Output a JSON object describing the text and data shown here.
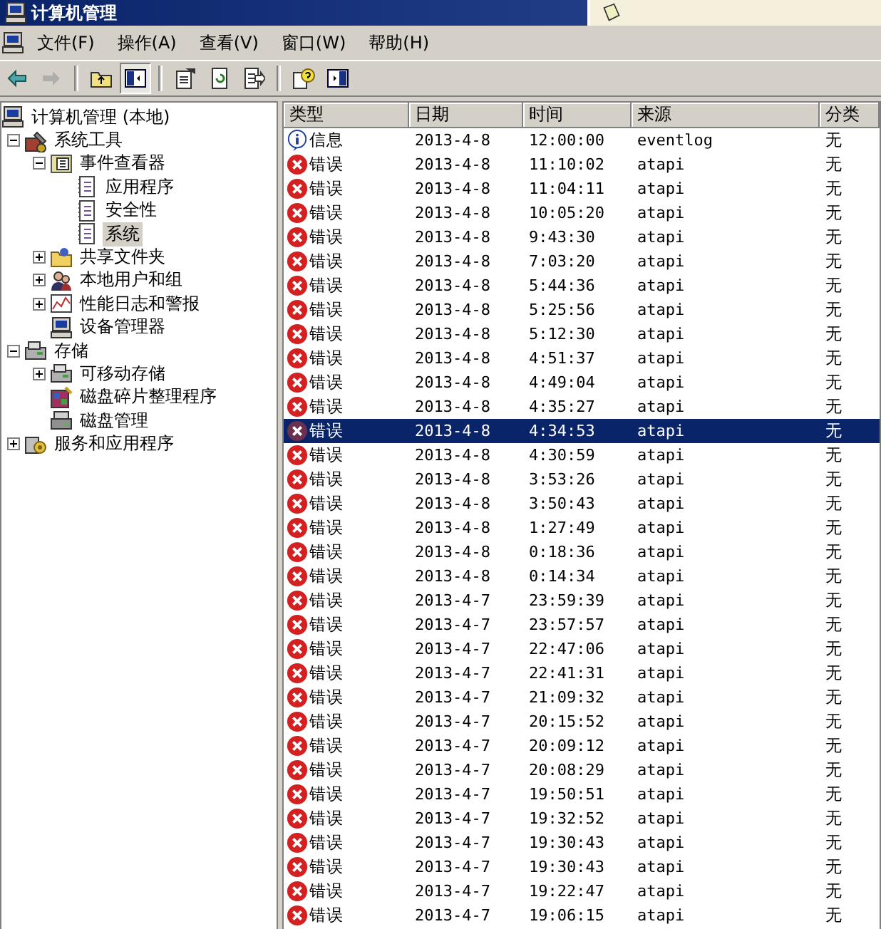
{
  "window": {
    "title": "计算机管理"
  },
  "menu": [
    "文件(F)",
    "操作(A)",
    "查看(V)",
    "窗口(W)",
    "帮助(H)"
  ],
  "toolbar": [
    {
      "kind": "back",
      "pressed": false,
      "disabled": false
    },
    {
      "kind": "forward",
      "pressed": false,
      "disabled": true
    },
    {
      "kind": "up",
      "pressed": false,
      "disabled": false
    },
    {
      "kind": "tree",
      "pressed": true,
      "disabled": false
    },
    {
      "kind": "properties",
      "pressed": false,
      "disabled": false
    },
    {
      "kind": "refresh",
      "pressed": false,
      "disabled": false
    },
    {
      "kind": "export",
      "pressed": false,
      "disabled": false
    },
    {
      "kind": "help",
      "pressed": false,
      "disabled": false
    },
    {
      "kind": "pane",
      "pressed": false,
      "disabled": false
    }
  ],
  "tree": {
    "label": "计算机管理 (本地)",
    "kind": "computer",
    "selected": false,
    "children": [
      {
        "label": "系统工具",
        "kind": "tools",
        "expanded": true,
        "selected": false,
        "children": [
          {
            "label": "事件查看器",
            "kind": "viewer",
            "expanded": true,
            "selected": false,
            "children": [
              {
                "label": "应用程序",
                "kind": "log",
                "selected": false
              },
              {
                "label": "安全性",
                "kind": "log",
                "selected": false
              },
              {
                "label": "系统",
                "kind": "log",
                "selected": true
              }
            ]
          },
          {
            "label": "共享文件夹",
            "kind": "folder",
            "expanded": false,
            "selected": false
          },
          {
            "label": "本地用户和组",
            "kind": "users",
            "expanded": false,
            "selected": false
          },
          {
            "label": "性能日志和警报",
            "kind": "chart",
            "expanded": false,
            "selected": false
          },
          {
            "label": "设备管理器",
            "kind": "computer",
            "selected": false
          }
        ]
      },
      {
        "label": "存储",
        "kind": "storage",
        "expanded": true,
        "selected": false,
        "children": [
          {
            "label": "可移动存储",
            "kind": "storage",
            "expanded": false,
            "selected": false
          },
          {
            "label": "磁盘碎片整理程序",
            "kind": "defrag",
            "selected": false
          },
          {
            "label": "磁盘管理",
            "kind": "disk",
            "selected": false
          }
        ]
      },
      {
        "label": "服务和应用程序",
        "kind": "services",
        "expanded": false,
        "selected": false
      }
    ]
  },
  "table": {
    "columns": [
      "类型",
      "日期",
      "时间",
      "来源",
      "分类"
    ],
    "rows": [
      {
        "kind": "info",
        "type": "信息",
        "date": "2013-4-8",
        "time": "12:00:00",
        "source": "eventlog",
        "category": "无",
        "selected": false
      },
      {
        "kind": "error",
        "type": "错误",
        "date": "2013-4-8",
        "time": "11:10:02",
        "source": "atapi",
        "category": "无",
        "selected": false
      },
      {
        "kind": "error",
        "type": "错误",
        "date": "2013-4-8",
        "time": "11:04:11",
        "source": "atapi",
        "category": "无",
        "selected": false
      },
      {
        "kind": "error",
        "type": "错误",
        "date": "2013-4-8",
        "time": "10:05:20",
        "source": "atapi",
        "category": "无",
        "selected": false
      },
      {
        "kind": "error",
        "type": "错误",
        "date": "2013-4-8",
        "time": "9:43:30",
        "source": "atapi",
        "category": "无",
        "selected": false
      },
      {
        "kind": "error",
        "type": "错误",
        "date": "2013-4-8",
        "time": "7:03:20",
        "source": "atapi",
        "category": "无",
        "selected": false
      },
      {
        "kind": "error",
        "type": "错误",
        "date": "2013-4-8",
        "time": "5:44:36",
        "source": "atapi",
        "category": "无",
        "selected": false
      },
      {
        "kind": "error",
        "type": "错误",
        "date": "2013-4-8",
        "time": "5:25:56",
        "source": "atapi",
        "category": "无",
        "selected": false
      },
      {
        "kind": "error",
        "type": "错误",
        "date": "2013-4-8",
        "time": "5:12:30",
        "source": "atapi",
        "category": "无",
        "selected": false
      },
      {
        "kind": "error",
        "type": "错误",
        "date": "2013-4-8",
        "time": "4:51:37",
        "source": "atapi",
        "category": "无",
        "selected": false
      },
      {
        "kind": "error",
        "type": "错误",
        "date": "2013-4-8",
        "time": "4:49:04",
        "source": "atapi",
        "category": "无",
        "selected": false
      },
      {
        "kind": "error",
        "type": "错误",
        "date": "2013-4-8",
        "time": "4:35:27",
        "source": "atapi",
        "category": "无",
        "selected": false
      },
      {
        "kind": "error",
        "type": "错误",
        "date": "2013-4-8",
        "time": "4:34:53",
        "source": "atapi",
        "category": "无",
        "selected": true
      },
      {
        "kind": "error",
        "type": "错误",
        "date": "2013-4-8",
        "time": "4:30:59",
        "source": "atapi",
        "category": "无",
        "selected": false
      },
      {
        "kind": "error",
        "type": "错误",
        "date": "2013-4-8",
        "time": "3:53:26",
        "source": "atapi",
        "category": "无",
        "selected": false
      },
      {
        "kind": "error",
        "type": "错误",
        "date": "2013-4-8",
        "time": "3:50:43",
        "source": "atapi",
        "category": "无",
        "selected": false
      },
      {
        "kind": "error",
        "type": "错误",
        "date": "2013-4-8",
        "time": "1:27:49",
        "source": "atapi",
        "category": "无",
        "selected": false
      },
      {
        "kind": "error",
        "type": "错误",
        "date": "2013-4-8",
        "time": "0:18:36",
        "source": "atapi",
        "category": "无",
        "selected": false
      },
      {
        "kind": "error",
        "type": "错误",
        "date": "2013-4-8",
        "time": "0:14:34",
        "source": "atapi",
        "category": "无",
        "selected": false
      },
      {
        "kind": "error",
        "type": "错误",
        "date": "2013-4-7",
        "time": "23:59:39",
        "source": "atapi",
        "category": "无",
        "selected": false
      },
      {
        "kind": "error",
        "type": "错误",
        "date": "2013-4-7",
        "time": "23:57:57",
        "source": "atapi",
        "category": "无",
        "selected": false
      },
      {
        "kind": "error",
        "type": "错误",
        "date": "2013-4-7",
        "time": "22:47:06",
        "source": "atapi",
        "category": "无",
        "selected": false
      },
      {
        "kind": "error",
        "type": "错误",
        "date": "2013-4-7",
        "time": "22:41:31",
        "source": "atapi",
        "category": "无",
        "selected": false
      },
      {
        "kind": "error",
        "type": "错误",
        "date": "2013-4-7",
        "time": "21:09:32",
        "source": "atapi",
        "category": "无",
        "selected": false
      },
      {
        "kind": "error",
        "type": "错误",
        "date": "2013-4-7",
        "time": "20:15:52",
        "source": "atapi",
        "category": "无",
        "selected": false
      },
      {
        "kind": "error",
        "type": "错误",
        "date": "2013-4-7",
        "time": "20:09:12",
        "source": "atapi",
        "category": "无",
        "selected": false
      },
      {
        "kind": "error",
        "type": "错误",
        "date": "2013-4-7",
        "time": "20:08:29",
        "source": "atapi",
        "category": "无",
        "selected": false
      },
      {
        "kind": "error",
        "type": "错误",
        "date": "2013-4-7",
        "time": "19:50:51",
        "source": "atapi",
        "category": "无",
        "selected": false
      },
      {
        "kind": "error",
        "type": "错误",
        "date": "2013-4-7",
        "time": "19:32:52",
        "source": "atapi",
        "category": "无",
        "selected": false
      },
      {
        "kind": "error",
        "type": "错误",
        "date": "2013-4-7",
        "time": "19:30:43",
        "source": "atapi",
        "category": "无",
        "selected": false
      },
      {
        "kind": "error",
        "type": "错误",
        "date": "2013-4-7",
        "time": "19:30:43",
        "source": "atapi",
        "category": "无",
        "selected": false
      },
      {
        "kind": "error",
        "type": "错误",
        "date": "2013-4-7",
        "time": "19:22:47",
        "source": "atapi",
        "category": "无",
        "selected": false
      },
      {
        "kind": "error",
        "type": "错误",
        "date": "2013-4-7",
        "time": "19:06:15",
        "source": "atapi",
        "category": "无",
        "selected": false
      }
    ]
  }
}
